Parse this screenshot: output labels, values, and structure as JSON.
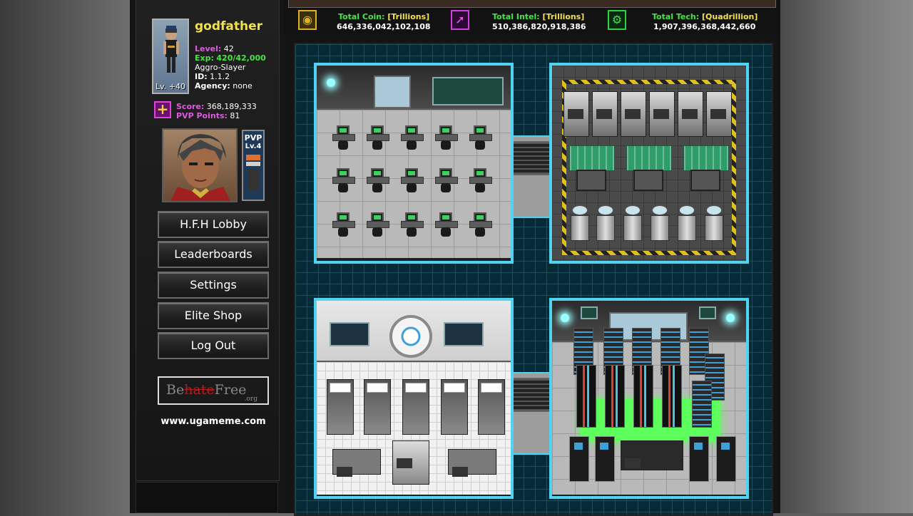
{
  "player": {
    "name": "godfather",
    "avatar_level": "Lv. +40",
    "level_label": "Level:",
    "level_value": "42",
    "exp_label": "Exp:",
    "exp_value": "420/42,000",
    "title": "Aggro-Slayer",
    "id_label": "ID:",
    "id_value": "1.1.2",
    "agency_label": "Agency:",
    "agency_value": "none",
    "score_label": "Score:",
    "score_value": "368,189,333",
    "pvp_points_label": "PVP Points:",
    "pvp_points_value": "81",
    "pvp_badge_label": "PVP",
    "pvp_badge_level": "Lv.4"
  },
  "menu": [
    {
      "label": "H.F.H Lobby"
    },
    {
      "label": "Leaderboards"
    },
    {
      "label": "Settings"
    },
    {
      "label": "Elite Shop"
    },
    {
      "label": "Log Out"
    }
  ],
  "sponsor": {
    "be": "Be",
    "hate": "hate",
    "free": "Free",
    "org": ".org"
  },
  "site_url": "www.ugameme.com",
  "resources": [
    {
      "icon": "coin-icon",
      "label": "Total Coin:",
      "unit": "[Trillions]",
      "value": "646,336,042,102,108",
      "color": "#e0b020"
    },
    {
      "icon": "intel-icon",
      "label": "Total Intel:",
      "unit": "[Trillions]",
      "value": "510,386,820,918,386",
      "color": "#b030d0"
    },
    {
      "icon": "tech-icon",
      "label": "Total Tech:",
      "unit": "[Quadrillion]",
      "value": "1,907,396,368,442,660",
      "color": "#30d040"
    }
  ],
  "colors": {
    "name": "#f2e24a",
    "magenta_label": "#e05ae0",
    "green_label": "#44e644",
    "room_border": "#4fd3f0",
    "grid_bg": "#062a36"
  }
}
